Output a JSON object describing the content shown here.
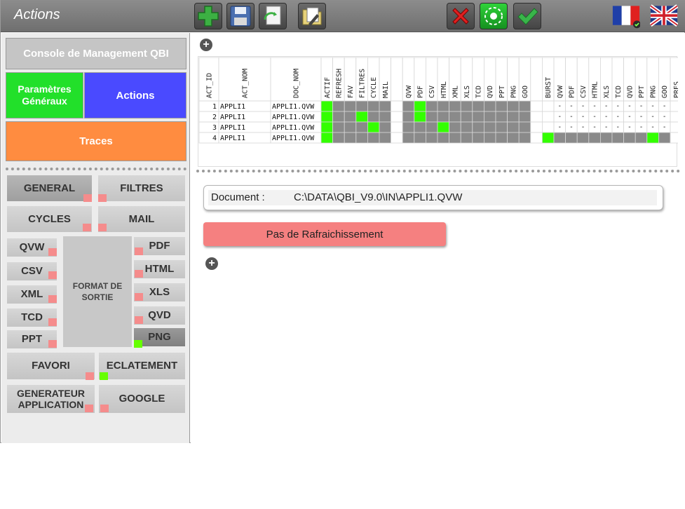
{
  "window": {
    "title": "Actions"
  },
  "toolbar": {
    "buttons": [
      {
        "icon": "add-icon",
        "color": "#3cb043"
      },
      {
        "icon": "save-icon"
      },
      {
        "icon": "refresh-doc-icon"
      },
      {
        "icon": "document-tools-icon"
      },
      {
        "icon": "cancel-icon",
        "color": "#e02020"
      },
      {
        "icon": "reload-icon",
        "color": "#22c22f"
      },
      {
        "icon": "validate-icon",
        "color": "#39b54a"
      }
    ],
    "languages": [
      {
        "icon": "flag-fr-icon",
        "selected": true
      },
      {
        "icon": "flag-uk-icon",
        "selected": false
      }
    ]
  },
  "nav": {
    "console": "Console de Management QBI",
    "params": "Paramètres Généraux",
    "actions": "Actions",
    "traces": "Traces",
    "colors": {
      "console": "#c5c5c5",
      "params": "#22e02a",
      "actions": "#4a4aff",
      "traces": "#ff8c40"
    }
  },
  "categories": {
    "general": {
      "label": "GENERAL",
      "active": false
    },
    "filtres": {
      "label": "FILTRES",
      "active": false
    },
    "cycles": {
      "label": "CYCLES",
      "active": false
    },
    "mail": {
      "label": "MAIL",
      "active": false
    },
    "format_box": "FORMAT DE SORTIE",
    "formats_left": [
      {
        "label": "QVW",
        "active": false
      },
      {
        "label": "CSV",
        "active": false
      },
      {
        "label": "XML",
        "active": false
      },
      {
        "label": "TCD",
        "active": false
      },
      {
        "label": "PPT",
        "active": false
      }
    ],
    "formats_right": [
      {
        "label": "PDF",
        "active": false
      },
      {
        "label": "HTML",
        "active": false
      },
      {
        "label": "XLS",
        "active": false
      },
      {
        "label": "QVD",
        "active": false
      },
      {
        "label": "PNG",
        "active": true
      }
    ],
    "favori": {
      "label": "FAVORI",
      "active": false
    },
    "eclatement": {
      "label": "ECLATEMENT",
      "active": true
    },
    "generateur": {
      "label": "GENERATEUR APPLICATION",
      "active": false
    },
    "google": {
      "label": "GOOGLE",
      "active": false
    }
  },
  "table": {
    "headers": [
      "ACT_ID",
      "ACT_NOM",
      "DOC_NOM",
      "ACTIF",
      "REFRESH",
      "FAV",
      "FILTRES",
      "CYCLE",
      "MAIL",
      "",
      "QVW",
      "PDF",
      "CSV",
      "HTML",
      "XML",
      "XLS",
      "TCD",
      "QVD",
      "PPT",
      "PNG",
      "GOO",
      "",
      "BURST",
      "QVW",
      "PDF",
      "CSV",
      "HTML",
      "XLS",
      "TCD",
      "QVD",
      "PPT",
      "PNG",
      "GOO",
      "PRES"
    ],
    "rows": [
      {
        "id": "1",
        "act": "APPLI1",
        "doc": "APPLI1.QVW",
        "flags": [
          "g",
          "d",
          "d",
          "d",
          "d",
          "d",
          "w",
          "d",
          "g",
          "d",
          "d",
          "d",
          "d",
          "d",
          "d",
          "d",
          "d",
          "d",
          "w",
          "w",
          "t",
          "t",
          "t",
          "t",
          "t",
          "t",
          "t",
          "t",
          "t",
          "t",
          "w"
        ]
      },
      {
        "id": "2",
        "act": "APPLI1",
        "doc": "APPLI1.QVW",
        "flags": [
          "g",
          "d",
          "d",
          "g",
          "d",
          "d",
          "w",
          "d",
          "g",
          "d",
          "d",
          "d",
          "d",
          "d",
          "d",
          "d",
          "d",
          "d",
          "w",
          "w",
          "t",
          "t",
          "t",
          "t",
          "t",
          "t",
          "t",
          "t",
          "t",
          "t",
          "w"
        ]
      },
      {
        "id": "3",
        "act": "APPLI1",
        "doc": "APPLI1.QVW",
        "flags": [
          "g",
          "d",
          "d",
          "d",
          "g",
          "d",
          "w",
          "d",
          "d",
          "d",
          "g",
          "d",
          "d",
          "d",
          "d",
          "d",
          "d",
          "d",
          "w",
          "w",
          "t",
          "t",
          "t",
          "t",
          "t",
          "t",
          "t",
          "t",
          "t",
          "t",
          "w"
        ]
      },
      {
        "id": "4",
        "act": "APPLI1",
        "doc": "APPLI1.QVW",
        "flags": [
          "g",
          "d",
          "d",
          "d",
          "d",
          "d",
          "w",
          "d",
          "d",
          "d",
          "d",
          "d",
          "d",
          "d",
          "d",
          "d",
          "d",
          "d",
          "w",
          "g",
          "d",
          "d",
          "d",
          "d",
          "d",
          "d",
          "d",
          "d",
          "g",
          "d",
          "w"
        ]
      }
    ],
    "colors": {
      "on": "#33ff00",
      "off": "#8a8a8a"
    }
  },
  "document": {
    "label": "Document :",
    "value": "C:\\DATA\\QBI_V9.0\\IN\\APPLI1.QVW"
  },
  "refresh_button": {
    "label": "Pas de Rafraichissement"
  }
}
